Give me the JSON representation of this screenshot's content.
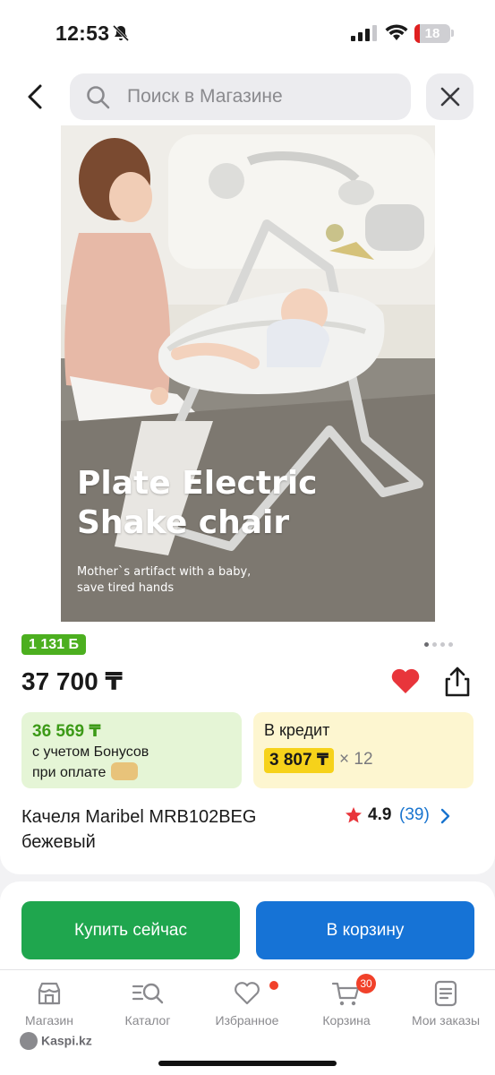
{
  "status_bar": {
    "time": "12:53",
    "battery": "18"
  },
  "header": {
    "search_placeholder": "Поиск в Магазине"
  },
  "product_image": {
    "headline_line1": "Plate Electric",
    "headline_line2": "Shake chair",
    "sub_line1": "Mother`s artifact with a baby,",
    "sub_line2": "save tired hands"
  },
  "bonus_badge": "1 131 Б",
  "gallery": {
    "total": 4,
    "active": 1
  },
  "price": "37 700 ₸",
  "favorite": true,
  "bonus_offer": {
    "price": "36 569 ₸",
    "line1": "с учетом Бонусов",
    "line2": "при оплате"
  },
  "credit": {
    "label": "В кредит",
    "monthly": "3 807 ₸",
    "multiplier": "× 12"
  },
  "product": {
    "title": "Качеля Maribel MRB102BEG бежевый",
    "rating": "4.9",
    "reviews": "(39)"
  },
  "actions": {
    "buy_now": "Купить сейчас",
    "add_to_cart": "В корзину"
  },
  "tabs": [
    {
      "label": "Магазин",
      "icon": "store-icon"
    },
    {
      "label": "Каталог",
      "icon": "catalog-search-icon"
    },
    {
      "label": "Избранное",
      "icon": "heart-icon"
    },
    {
      "label": "Корзина",
      "icon": "cart-icon",
      "badge": "30"
    },
    {
      "label": "Мои заказы",
      "icon": "orders-icon"
    }
  ],
  "watermark": "Kaspi.kz",
  "colors": {
    "accent_green": "#1fa64e",
    "accent_blue": "#1673d6",
    "badge_red": "#f1412a",
    "bonus_green": "#4caf1f",
    "credit_yellow": "#f6d21a"
  }
}
